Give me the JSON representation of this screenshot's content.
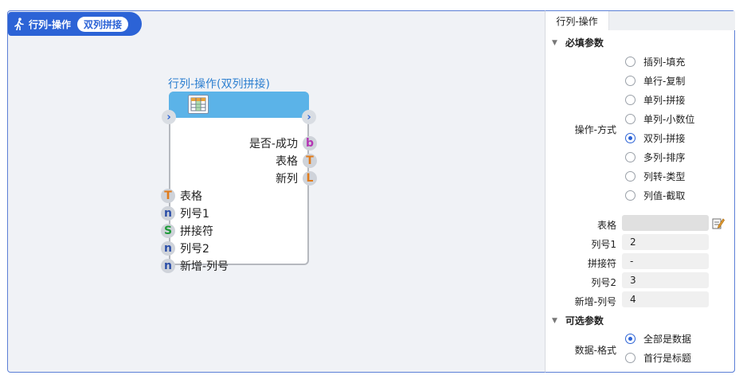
{
  "header": {
    "title": "行列-操作",
    "badge": "双列拼接"
  },
  "node": {
    "title": "行列-操作(双列拼接)",
    "outputs": [
      {
        "label": "是否-成功",
        "type": "b"
      },
      {
        "label": "表格",
        "type": "T"
      },
      {
        "label": "新列",
        "type": "L"
      }
    ],
    "inputs": [
      {
        "label": "表格",
        "type": "T"
      },
      {
        "label": "列号1",
        "type": "n"
      },
      {
        "label": "拼接符",
        "type": "S"
      },
      {
        "label": "列号2",
        "type": "n"
      },
      {
        "label": "新增-列号",
        "type": "n"
      }
    ]
  },
  "panel": {
    "tab": "行列-操作",
    "required_section": "必填参数",
    "operation_label": "操作-方式",
    "operation_options": [
      "插列-填充",
      "单行-复制",
      "单列-拼接",
      "单列-小数位",
      "双列-拼接",
      "多列-排序",
      "列转-类型",
      "列值-截取"
    ],
    "operation_selected": 4,
    "fields": [
      {
        "label": "表格",
        "value": ""
      },
      {
        "label": "列号1",
        "value": "2"
      },
      {
        "label": "拼接符",
        "value": "-"
      },
      {
        "label": "列号2",
        "value": "3"
      },
      {
        "label": "新增-列号",
        "value": "4"
      }
    ],
    "optional_section": "可选参数",
    "data_format_label": "数据-格式",
    "data_format_options": [
      "全部是数据",
      "首行是标题"
    ],
    "data_format_selected": 0
  },
  "colors": {
    "accent": "#2c63d6",
    "node_header": "#5bb3e8",
    "node_title": "#2c7fd0"
  }
}
